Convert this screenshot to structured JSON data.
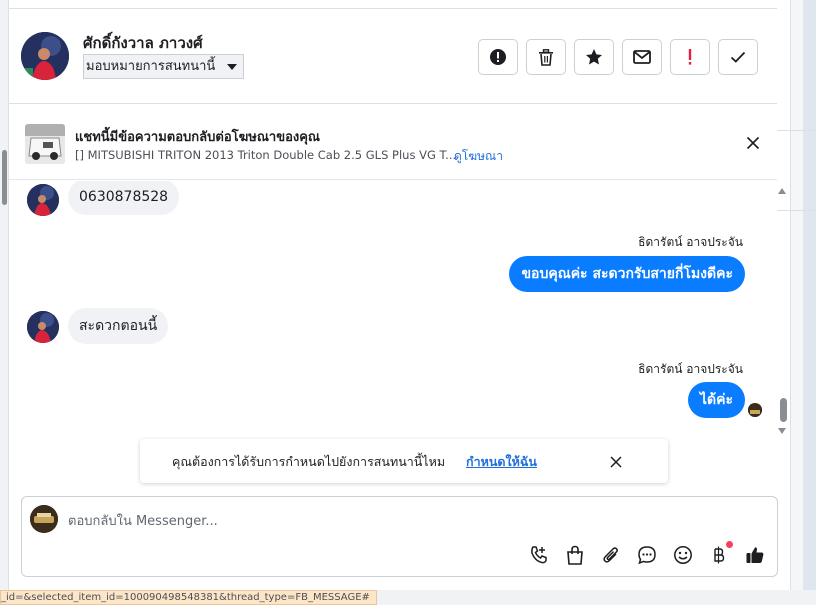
{
  "header": {
    "contact_name": "ศักดิ์กังวาล ภาวงศ์",
    "assign_label": "มอบหมายการสนทนานี้",
    "actions": [
      "alert-circle-icon",
      "trash-icon",
      "star-icon",
      "envelope-icon",
      "exclamation-icon",
      "check-icon"
    ]
  },
  "ad_banner": {
    "title": "แชทนี้มีข้อความตอบกลับต่อโฆษณาของคุณ",
    "subtitle": "[] MITSUBISHI TRITON 2013 Triton Double Cab 2.5 GLS Plus VG T...",
    "link": "ดูโฆษณา"
  },
  "messages": [
    {
      "direction": "in",
      "text": "0630878528"
    },
    {
      "direction": "out",
      "sender": "ธิดารัตน์ อาจประจัน",
      "text": "ขอบคุณค่ะ สะดวกรับสายกี่โมงดีคะ"
    },
    {
      "direction": "in",
      "text": "สะดวกตอนนี้"
    },
    {
      "direction": "out",
      "sender": "ธิดารัตน์ อาจประจัน",
      "text": "ได้ค่ะ"
    }
  ],
  "toast": {
    "text": "คุณต้องการได้รับการกำหนดไปยังการสนทนานี้ไหม",
    "link": "กำหนดให้ฉัน"
  },
  "composer": {
    "placeholder": "ตอบกลับใน Messenger...",
    "icons": [
      "phone-plus-icon",
      "shopping-bag-icon",
      "paperclip-icon",
      "speech-bubble-icon",
      "emoji-icon",
      "baht-icon",
      "thumbs-up-icon"
    ]
  },
  "url_fragment": "_id=&selected_item_id=100090498548381&thread_type=FB_MESSAGE#",
  "colors": {
    "outgoing_bubble": "#0a7cff",
    "incoming_bubble": "#f0f2f5",
    "link": "#216fdb",
    "notification_dot": "#f3425f"
  }
}
